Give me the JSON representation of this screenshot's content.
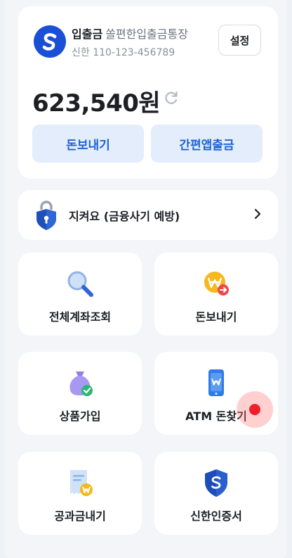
{
  "account": {
    "type": "입출금",
    "product": "쏠편한입출금통장",
    "bank_number": "신한 110-123-456789",
    "settings_label": "설정",
    "balance": "623,540원",
    "buttons": {
      "transfer": "돈보내기",
      "app_withdraw": "간편앱출금"
    }
  },
  "fraud_banner": {
    "label": "지켜요 (금융사기 예방)"
  },
  "menu": {
    "items": [
      {
        "label": "전체계좌조회",
        "icon": "magnifier-icon"
      },
      {
        "label": "돈보내기",
        "icon": "won-coin-send-icon"
      },
      {
        "label": "상품가입",
        "icon": "money-bag-check-icon"
      },
      {
        "label": "ATM 돈찾기",
        "icon": "phone-won-icon"
      },
      {
        "label": "공과금내기",
        "icon": "bill-won-icon"
      },
      {
        "label": "신한인증서",
        "icon": "shield-s-icon"
      }
    ]
  },
  "colors": {
    "accent": "#1f63d4",
    "button_bg": "#e3edfb",
    "background": "#eef1f6",
    "touch_indicator": "#f0202a"
  }
}
